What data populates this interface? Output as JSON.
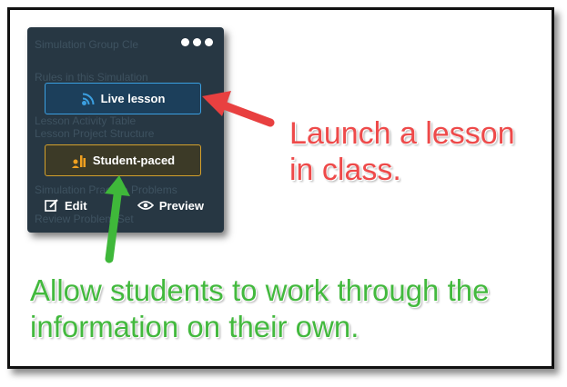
{
  "card": {
    "ghost_lines": [
      "Simulation Group Cle",
      "Rules in this Simulation",
      "Lesson Activity Table",
      "Lesson Project Structure",
      "Simulation Practice Problems",
      "Review Problem Set"
    ],
    "live_lesson_label": "Live lesson",
    "student_paced_label": "Student-paced",
    "edit_label": "Edit",
    "preview_label": "Preview",
    "colors": {
      "background": "#273743",
      "live_border": "#3b9fe0",
      "live_icon": "#3b9fe0",
      "student_border": "#d4a02c",
      "student_icon": "#f0a020"
    }
  },
  "annotations": {
    "launch_text": "Launch a lesson in class.",
    "allow_text": "Allow students to work through the information on their own.",
    "colors": {
      "red": "#ee4a4a",
      "green": "#43b93e"
    }
  }
}
